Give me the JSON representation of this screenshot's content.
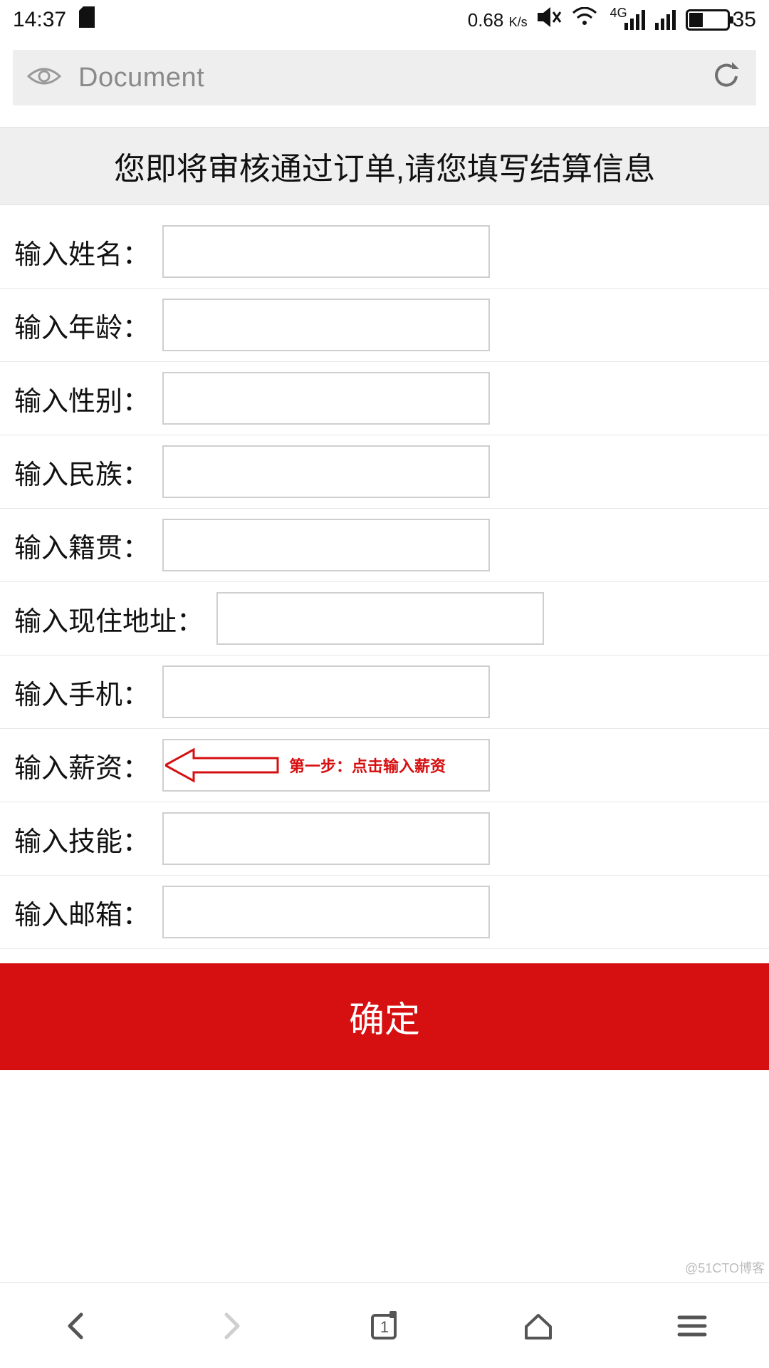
{
  "status": {
    "time": "14:37",
    "net_speed": "0.68",
    "net_unit": "K/s",
    "net_type": "4G",
    "battery_pct": "35"
  },
  "browser": {
    "title": "Document"
  },
  "page": {
    "header": "您即将审核通过订单,请您填写结算信息"
  },
  "form": {
    "rows": [
      {
        "label": "输入姓名：",
        "value": ""
      },
      {
        "label": "输入年龄：",
        "value": ""
      },
      {
        "label": "输入性别：",
        "value": ""
      },
      {
        "label": "输入民族：",
        "value": ""
      },
      {
        "label": "输入籍贯：",
        "value": ""
      },
      {
        "label": "输入现住地址：",
        "value": ""
      },
      {
        "label": "输入手机：",
        "value": ""
      },
      {
        "label": "输入薪资：",
        "value": ""
      },
      {
        "label": "输入技能：",
        "value": ""
      },
      {
        "label": "输入邮箱：",
        "value": ""
      }
    ],
    "confirm_label": "确定"
  },
  "annotation": {
    "text": "第一步：点击输入薪资"
  },
  "watermark": "@51CTO博客"
}
